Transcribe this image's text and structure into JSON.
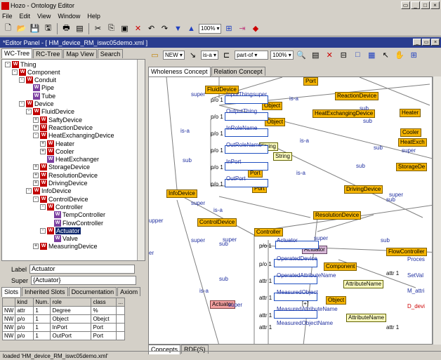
{
  "window": {
    "title": "Hozo - Ontology Editor"
  },
  "menu": [
    "File",
    "Edit",
    "View",
    "Window",
    "Help"
  ],
  "toolbar": {
    "zoom": "100%"
  },
  "panel": {
    "title": "*Editor Panel - [ HM_device_RM_iswc05demo.xml ]"
  },
  "left_tabs": [
    "WC-Tree",
    "RC-Tree",
    "Map View",
    "Search"
  ],
  "tree": [
    {
      "label": "Thing",
      "depth": 0,
      "exp": "-"
    },
    {
      "label": "Component",
      "depth": 1,
      "exp": "-"
    },
    {
      "label": "Conduit",
      "depth": 2,
      "exp": "-"
    },
    {
      "label": "Pipe",
      "depth": 3,
      "exp": ""
    },
    {
      "label": "Tube",
      "depth": 3,
      "exp": ""
    },
    {
      "label": "Device",
      "depth": 2,
      "exp": "-"
    },
    {
      "label": "FluidDevice",
      "depth": 3,
      "exp": "-"
    },
    {
      "label": "SaftyDevice",
      "depth": 4,
      "exp": "+"
    },
    {
      "label": "ReactionDevice",
      "depth": 4,
      "exp": "+"
    },
    {
      "label": "HeatExchangingDevice",
      "depth": 4,
      "exp": "-"
    },
    {
      "label": "Heater",
      "depth": 5,
      "exp": "+"
    },
    {
      "label": "Cooler",
      "depth": 5,
      "exp": "+"
    },
    {
      "label": "HeatExchanger",
      "depth": 5,
      "exp": ""
    },
    {
      "label": "StorageDevice",
      "depth": 4,
      "exp": "+"
    },
    {
      "label": "ResolutionDevice",
      "depth": 4,
      "exp": "+"
    },
    {
      "label": "DrivingDevice",
      "depth": 4,
      "exp": "+"
    },
    {
      "label": "InfoDevice",
      "depth": 3,
      "exp": "-"
    },
    {
      "label": "ControlDevice",
      "depth": 4,
      "exp": "-"
    },
    {
      "label": "Controller",
      "depth": 5,
      "exp": "-"
    },
    {
      "label": "TempController",
      "depth": 6,
      "exp": ""
    },
    {
      "label": "FlowController",
      "depth": 6,
      "exp": ""
    },
    {
      "label": "Actuator",
      "depth": 5,
      "exp": "-",
      "sel": true
    },
    {
      "label": "Valve",
      "depth": 6,
      "exp": ""
    },
    {
      "label": "MeasuringDevice",
      "depth": 4,
      "exp": "+"
    }
  ],
  "props": {
    "label_caption": "Label",
    "label_value": "Actuator",
    "super_caption": "Super",
    "super_value": "{Actuator}"
  },
  "slot_tabs": [
    "Slots",
    "Inherited Slots",
    "Documentation",
    "Axiom"
  ],
  "slot_table": {
    "headers": [
      "",
      "kind",
      "Num.",
      "role",
      "class",
      "..."
    ],
    "rows": [
      [
        "NW",
        "attr",
        "1",
        "Degree",
        "%",
        ""
      ],
      [
        "NW",
        "p/o",
        "1",
        "Object",
        "Obejct",
        ""
      ],
      [
        "NW",
        "p/o",
        "1",
        "InPort",
        "Port",
        ""
      ],
      [
        "NW",
        "p/o",
        "1",
        "OutPort",
        "Port",
        ""
      ]
    ]
  },
  "canvas_toolbar": {
    "new": "NEW",
    "isa": "is-a",
    "partof": "part-of",
    "zoom": "100%"
  },
  "canvas_tabs": [
    "Wholeness Concept",
    "Relation Concept"
  ],
  "bottom_tabs": [
    "Concepts",
    "RDF(S)"
  ],
  "status": "loaded 'HM_device_RM_iswc05demo.xml'",
  "canvas": {
    "nodes": [
      {
        "t": "Port",
        "c": "o"
      },
      {
        "t": "FluidDevice",
        "c": "o"
      },
      {
        "t": "ReactionDevice",
        "c": "o"
      },
      {
        "t": "Object",
        "c": "o"
      },
      {
        "t": "HeatExchangingDevice",
        "c": "o"
      },
      {
        "t": "Heater",
        "c": "o"
      },
      {
        "t": "Object",
        "c": "o"
      },
      {
        "t": "Cooler",
        "c": "o"
      },
      {
        "t": "HeatExch",
        "c": "o"
      },
      {
        "t": "String",
        "c": "y"
      },
      {
        "t": "String",
        "c": "y"
      },
      {
        "t": "StorageDe",
        "c": "o"
      },
      {
        "t": "Port",
        "c": "o"
      },
      {
        "t": "Port",
        "c": "o"
      },
      {
        "t": "DrivingDevice",
        "c": "o"
      },
      {
        "t": "InfoDevice",
        "c": "o"
      },
      {
        "t": "ResolutionDevice",
        "c": "o"
      },
      {
        "t": "ControlDevice",
        "c": "o"
      },
      {
        "t": "Controller",
        "c": "o"
      },
      {
        "t": "Actuator",
        "c": "pp"
      },
      {
        "t": "FlowController",
        "c": "o"
      },
      {
        "t": "Component",
        "c": "o"
      },
      {
        "t": "AttributeName",
        "c": "y"
      },
      {
        "t": "Object",
        "c": "o"
      },
      {
        "t": "Actuator",
        "c": "pk"
      },
      {
        "t": "AttributeName",
        "c": "y"
      }
    ],
    "labels": [
      "p/o 1",
      "InputThing",
      "p/o 1",
      "OutputThing",
      "p/o 1",
      "InRoleName",
      "p/o 1",
      "OutRoleName",
      "p/o 1",
      "InPort",
      "p/o 1",
      "OutPort",
      "p/o 1",
      "Actuator",
      "p/o 1",
      "OperatedDevice",
      "attr 1",
      "OperatedAttributeName",
      "attr 1",
      "MeasuredObject",
      "attr 1",
      "MeasuredAttributeName",
      "attr 1",
      "MeasuredObjectName",
      "attr 1",
      "attr 1",
      "Proces",
      "SetVal",
      "M_attri",
      "D_devi",
      "[+]"
    ],
    "rel": [
      "super",
      "super",
      "is-a",
      "sub",
      "sub",
      "is-a",
      "is-a",
      "sub",
      "sub",
      "super",
      "is-a",
      "sub",
      "super",
      "super",
      "is-a",
      "sub",
      "super",
      "super",
      "sub",
      "is-a",
      "super",
      "sub",
      "upper",
      "super",
      "sub",
      "er",
      "sub"
    ]
  }
}
